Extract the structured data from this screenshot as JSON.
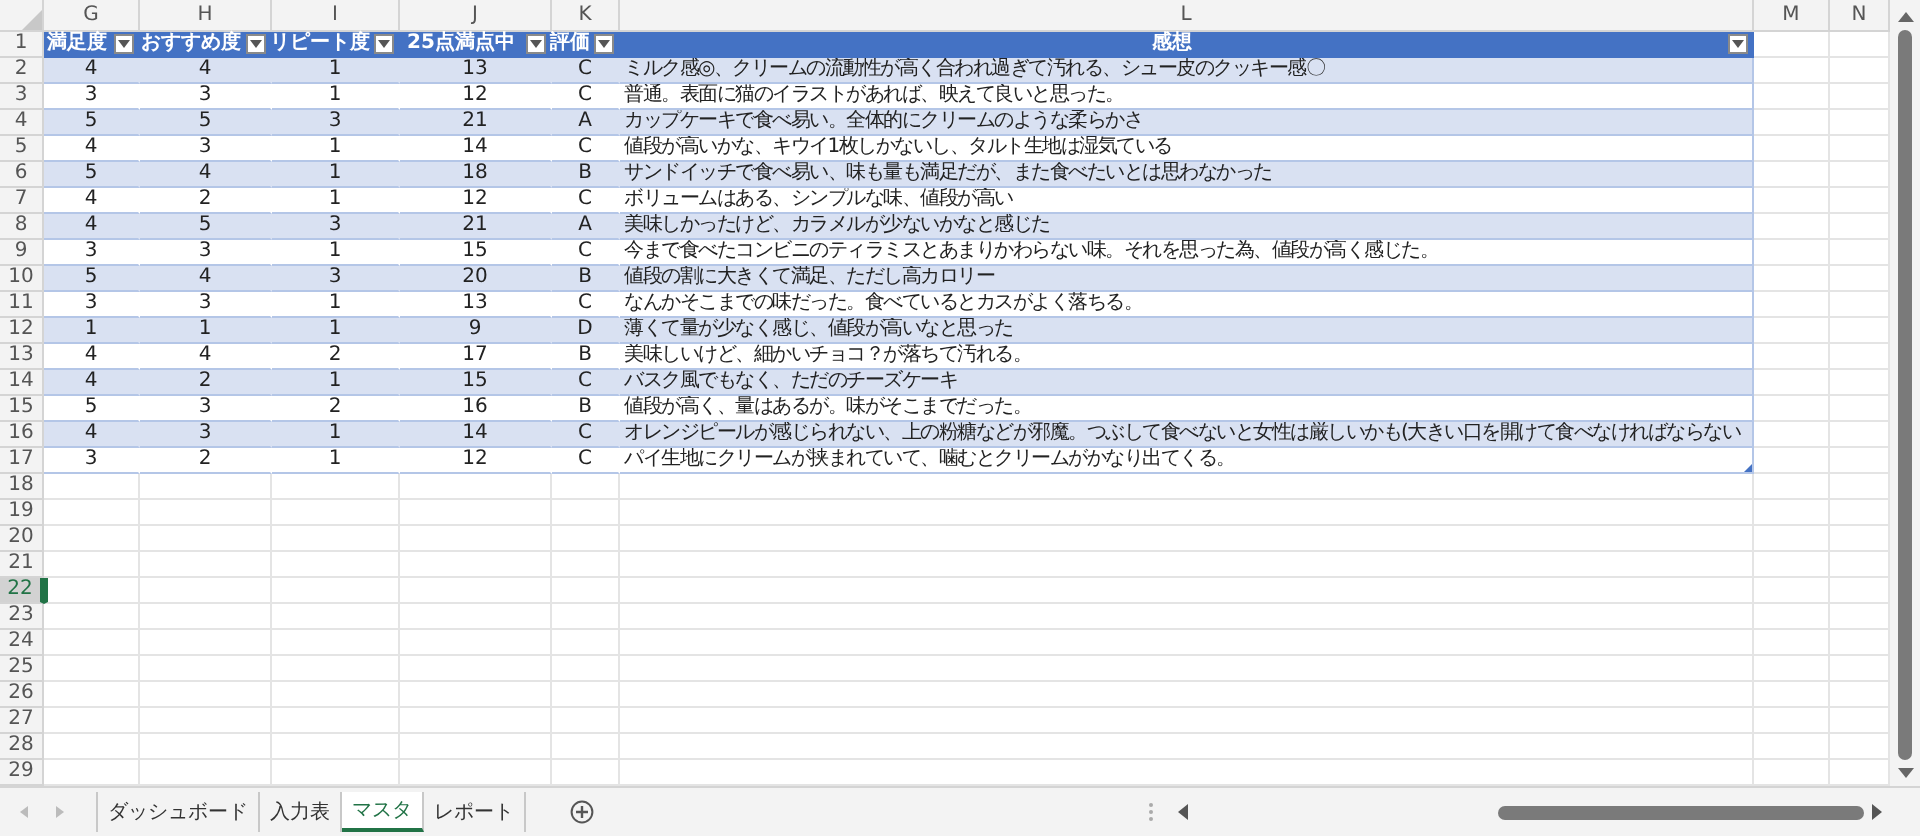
{
  "column_letters": [
    "G",
    "H",
    "I",
    "J",
    "K",
    "L",
    "M",
    "N"
  ],
  "row_numbers": [
    {
      "label": "1",
      "selected": false
    },
    {
      "label": "2",
      "selected": false
    },
    {
      "label": "3",
      "selected": false
    },
    {
      "label": "4",
      "selected": false
    },
    {
      "label": "5",
      "selected": false
    },
    {
      "label": "6",
      "selected": false
    },
    {
      "label": "7",
      "selected": false
    },
    {
      "label": "8",
      "selected": false
    },
    {
      "label": "9",
      "selected": false
    },
    {
      "label": "10",
      "selected": false
    },
    {
      "label": "11",
      "selected": false
    },
    {
      "label": "12",
      "selected": false
    },
    {
      "label": "13",
      "selected": false
    },
    {
      "label": "14",
      "selected": false
    },
    {
      "label": "15",
      "selected": false
    },
    {
      "label": "16",
      "selected": false
    },
    {
      "label": "17",
      "selected": false
    },
    {
      "label": "18",
      "selected": false
    },
    {
      "label": "19",
      "selected": false
    },
    {
      "label": "20",
      "selected": false
    },
    {
      "label": "21",
      "selected": false
    },
    {
      "label": "22",
      "selected": true
    },
    {
      "label": "23",
      "selected": false
    },
    {
      "label": "24",
      "selected": false
    },
    {
      "label": "25",
      "selected": false
    },
    {
      "label": "26",
      "selected": false
    },
    {
      "label": "27",
      "selected": false
    },
    {
      "label": "28",
      "selected": false
    },
    {
      "label": "29",
      "selected": false
    }
  ],
  "table": {
    "columns": [
      "満足度",
      "おすすめ度",
      "リピート度",
      "25点満点中",
      "評価",
      "感想"
    ],
    "rows": [
      [
        "4",
        "4",
        "1",
        "13",
        "C",
        "ミルク感◎、クリームの流動性が高く合われ過ぎて汚れる、シュー皮のクッキー感〇"
      ],
      [
        "3",
        "3",
        "1",
        "12",
        "C",
        "普通。表面に猫のイラストがあれば、映えて良いと思った。"
      ],
      [
        "5",
        "5",
        "3",
        "21",
        "A",
        "カップケーキで食べ易い。全体的にクリームのような柔らかさ"
      ],
      [
        "4",
        "3",
        "1",
        "14",
        "C",
        "値段が高いかな、キウイ1枚しかないし、タルト生地は湿気ている"
      ],
      [
        "5",
        "4",
        "1",
        "18",
        "B",
        "サンドイッチで食べ易い、味も量も満足だが、また食べたいとは思わなかった"
      ],
      [
        "4",
        "2",
        "1",
        "12",
        "C",
        "ボリュームはある、シンプルな味、値段が高い"
      ],
      [
        "4",
        "5",
        "3",
        "21",
        "A",
        "美味しかったけど、カラメルが少ないかなと感じた"
      ],
      [
        "3",
        "3",
        "1",
        "15",
        "C",
        "今まで食べたコンビニのティラミスとあまりかわらない味。それを思った為、値段が高く感じた。"
      ],
      [
        "5",
        "4",
        "3",
        "20",
        "B",
        "値段の割に大きくて満足、ただし高カロリー"
      ],
      [
        "3",
        "3",
        "1",
        "13",
        "C",
        "なんかそこまでの味だった。食べているとカスがよく落ちる。"
      ],
      [
        "1",
        "1",
        "1",
        "9",
        "D",
        "薄くて量が少なく感じ、値段が高いなと思った"
      ],
      [
        "4",
        "4",
        "2",
        "17",
        "B",
        "美味しいけど、細かいチョコ？が落ちて汚れる。"
      ],
      [
        "4",
        "2",
        "1",
        "15",
        "C",
        "バスク風でもなく、ただのチーズケーキ"
      ],
      [
        "5",
        "3",
        "2",
        "16",
        "B",
        "値段が高く、量はあるが。味がそこまでだった。"
      ],
      [
        "4",
        "3",
        "1",
        "14",
        "C",
        "オレンジピールが感じられない、上の粉糖などが邪魔。つぶして食べないと女性は厳しいかも(大きい口を開けて食べなければならない"
      ],
      [
        "3",
        "2",
        "1",
        "12",
        "C",
        "パイ生地にクリームが挟まれていて、噛むとクリームがかなり出てくる。"
      ]
    ]
  },
  "sheet_tabs": [
    {
      "label": "ダッシュボード",
      "selected": false
    },
    {
      "label": "入力表",
      "selected": false
    },
    {
      "label": "マスタ",
      "selected": true
    },
    {
      "label": "レポート",
      "selected": false
    }
  ]
}
